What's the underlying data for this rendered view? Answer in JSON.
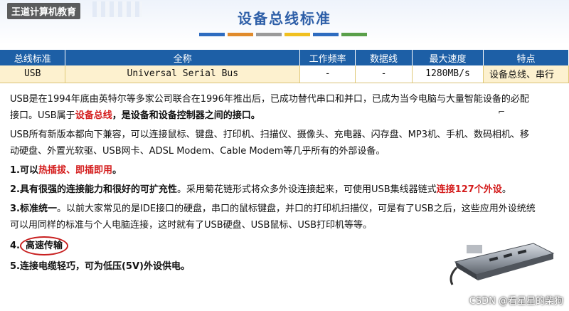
{
  "brand": "王道计算机教育",
  "title": "设备总线标准",
  "colors": {
    "header_bg": "#1d5fa6",
    "title": "#2e5fa8",
    "highlight": "#d41d1d",
    "strips": [
      "#2e6cc0",
      "#e08b2c",
      "#9a9a9a",
      "#f0c020",
      "#2e6cc0",
      "#5aa04a"
    ]
  },
  "table": {
    "headers": [
      "总线标准",
      "全称",
      "工作频率",
      "数据线",
      "最大速度",
      "特点"
    ],
    "row": [
      "USB",
      "Universal Serial Bus",
      "-",
      "-",
      "1280MB/s",
      "设备总线、串行"
    ]
  },
  "content": {
    "p1a": "USB是在1994年底由英特尔等多家公司联合在1996年推出后，已成功替代串口和并口，已成为当今电脑与大量智能设备的必配接口。USB属于",
    "p1b": "设备总线",
    "p1c": "，是设备和设备控制器之间的接口。",
    "p2": "USB所有新版本都向下兼容，可以连接鼠标、键盘、打印机、扫描仪、摄像头、充电器、闪存盘、MP3机、手机、数码相机、移动硬盘、外置光软驱、USB网卡、ADSL Modem、Cable Modem等几乎所有的外部设备。",
    "i1a": "1.可以",
    "i1b": "热插拔",
    "i1c": "、",
    "i1d": "即插即用",
    "i1e": "。",
    "i2a": "2.具有很强的连接能力和很好的可扩充性",
    "i2b": "。采用菊花链形式将众多外设连接起来，可使用USB集线器链式",
    "i2c": "连接127个外设",
    "i2d": "。",
    "i3a": "3.标准统一",
    "i3b": "。以前大家常见的是IDE接口的硬盘，串口的鼠标键盘，并口的打印机扫描仪，可是有了USB之后，这些应用外设统统可以用同样的标准与个人电脑连接，这时就有了USB硬盘、USB鼠标、USB打印机等等。",
    "i4a": "4.",
    "i4b": "高速传输",
    "i5": "5.连接电缆轻巧，可为低压(5V)外设供电。"
  },
  "credit": "CSDN @看星星的柴狗",
  "icons": [
    "usb-hub-image",
    "cursor-icon"
  ]
}
